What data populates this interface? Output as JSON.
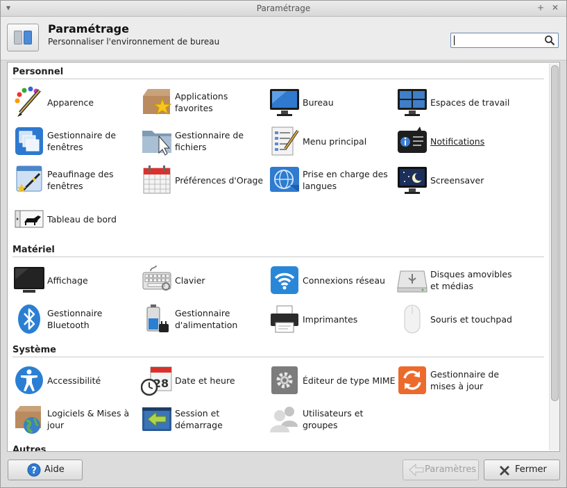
{
  "window": {
    "title": "Paramétrage"
  },
  "header": {
    "title": "Paramétrage",
    "subtitle": "Personnaliser l'environnement de bureau",
    "search": {
      "value": "",
      "placeholder": ""
    }
  },
  "sections": [
    {
      "title": "Personnel",
      "items": [
        {
          "label": "Apparence",
          "icon": "palette-brush-icon"
        },
        {
          "label": "Applications favorites",
          "icon": "box-star-icon"
        },
        {
          "label": "Bureau",
          "icon": "desktop-monitor-icon"
        },
        {
          "label": "Espaces de travail",
          "icon": "workspaces-icon"
        },
        {
          "label": "Gestionnaire de fenêtres",
          "icon": "window-manager-icon"
        },
        {
          "label": "Gestionnaire de fichiers",
          "icon": "folder-icon"
        },
        {
          "label": "Menu principal",
          "icon": "menu-editor-icon"
        },
        {
          "label": "Notifications",
          "icon": "notifications-icon"
        },
        {
          "label": "Peaufinage des fenêtres",
          "icon": "window-tweaks-icon"
        },
        {
          "label": "Préférences d'Orage",
          "icon": "calendar-icon"
        },
        {
          "label": "Prise en charge des langues",
          "icon": "language-globe-icon"
        },
        {
          "label": "Screensaver",
          "icon": "screensaver-icon"
        },
        {
          "label": "Tableau de bord",
          "icon": "panel-icon"
        }
      ]
    },
    {
      "title": "Matériel",
      "items": [
        {
          "label": "Affichage",
          "icon": "display-icon"
        },
        {
          "label": "Clavier",
          "icon": "keyboard-icon"
        },
        {
          "label": "Connexions réseau",
          "icon": "wifi-icon"
        },
        {
          "label": "Disques amovibles et médias",
          "icon": "removable-drive-icon"
        },
        {
          "label": "Gestionnaire Bluetooth",
          "icon": "bluetooth-icon"
        },
        {
          "label": "Gestionnaire d'alimentation",
          "icon": "battery-icon"
        },
        {
          "label": "Imprimantes",
          "icon": "printer-icon"
        },
        {
          "label": "Souris et touchpad",
          "icon": "mouse-icon"
        }
      ]
    },
    {
      "title": "Système",
      "items": [
        {
          "label": "Accessibilité",
          "icon": "accessibility-icon"
        },
        {
          "label": "Date et heure",
          "icon": "date-time-icon"
        },
        {
          "label": "Éditeur de type MIME",
          "icon": "mime-gear-icon"
        },
        {
          "label": "Gestionnaire de mises à jour",
          "icon": "update-manager-icon"
        },
        {
          "label": "Logiciels & Mises à jour",
          "icon": "software-globe-icon"
        },
        {
          "label": "Session et démarrage",
          "icon": "session-arrow-icon"
        },
        {
          "label": "Utilisateurs et groupes",
          "icon": "users-icon"
        }
      ]
    },
    {
      "title": "Autres",
      "items": []
    }
  ],
  "footer": {
    "help": "Aide",
    "settings": "Paramètres",
    "close": "Fermer"
  }
}
